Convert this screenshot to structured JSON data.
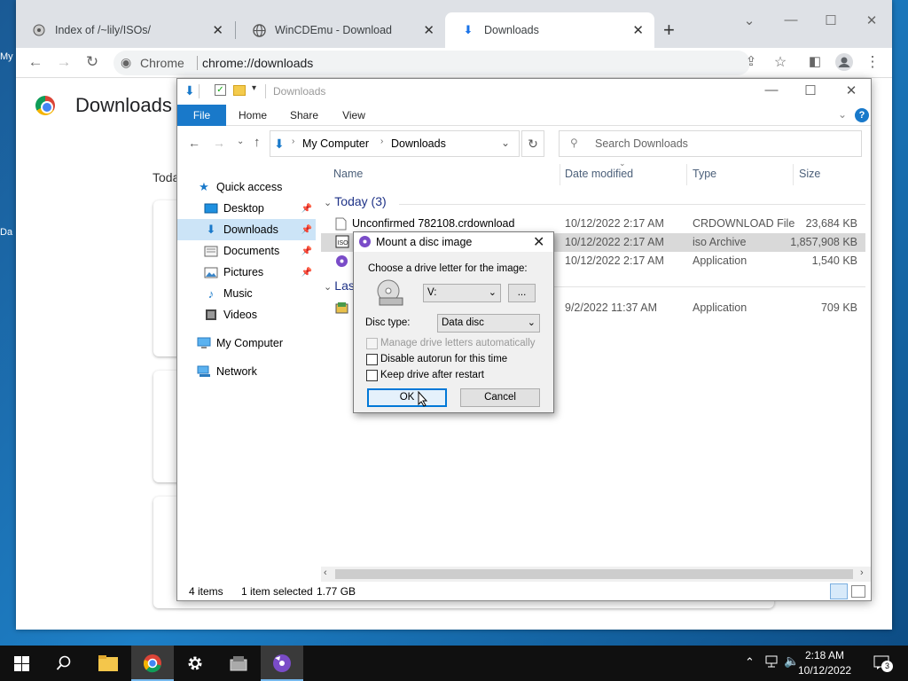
{
  "desktop": {
    "icon_labels": [
      "My",
      "Da"
    ]
  },
  "browser": {
    "tabs": [
      {
        "title": "Index of /~lily/ISOs/"
      },
      {
        "title": "WinCDEmu - Download"
      },
      {
        "title": "Downloads"
      }
    ],
    "omnibox": {
      "site_label": "Chrome",
      "url": "chrome://downloads"
    },
    "page": {
      "title": "Downloads",
      "section_label": "Toda"
    }
  },
  "explorer": {
    "title": "Downloads",
    "ribbon_tabs": [
      "File",
      "Home",
      "Share",
      "View"
    ],
    "help": "?",
    "breadcrumb": [
      "My Computer",
      "Downloads"
    ],
    "search_placeholder": "Search Downloads",
    "nav": [
      {
        "label": "Quick access",
        "icon": "star-icon"
      },
      {
        "label": "Desktop",
        "icon": "desktop-icon",
        "pinned": true
      },
      {
        "label": "Downloads",
        "icon": "download-arrow-icon",
        "pinned": true,
        "selected": true
      },
      {
        "label": "Documents",
        "icon": "documents-icon",
        "pinned": true
      },
      {
        "label": "Pictures",
        "icon": "pictures-icon",
        "pinned": true
      },
      {
        "label": "Music",
        "icon": "music-icon"
      },
      {
        "label": "Videos",
        "icon": "videos-icon"
      },
      {
        "label": "My Computer",
        "icon": "computer-icon"
      },
      {
        "label": "Network",
        "icon": "network-icon"
      }
    ],
    "columns": [
      "Name",
      "Date modified",
      "Type",
      "Size"
    ],
    "groups": [
      {
        "label": "Today (3)"
      },
      {
        "label": "Las"
      }
    ],
    "files": [
      {
        "name": "Unconfirmed 782108.crdownload",
        "date": "10/12/2022 2:17 AM",
        "type": "CRDOWNLOAD File",
        "size": "23,684 KB"
      },
      {
        "name": "",
        "date": "10/12/2022 2:17 AM",
        "type": "iso Archive",
        "size": "1,857,908 KB"
      },
      {
        "name": "",
        "date": "10/12/2022 2:17 AM",
        "type": "Application",
        "size": "1,540 KB"
      },
      {
        "name": "",
        "date": "9/2/2022 11:37 AM",
        "type": "Application",
        "size": "709 KB"
      }
    ],
    "status": {
      "items": "4 items",
      "selected": "1 item selected",
      "size": "1.77 GB"
    }
  },
  "dialog": {
    "title": "Mount a disc image",
    "drive_prompt": "Choose a drive letter for the image:",
    "drive_value": "V:",
    "browse_label": "...",
    "disc_type_label": "Disc type:",
    "disc_type_value": "Data disc",
    "opt_manage": "Manage drive letters automatically",
    "opt_autorun": "Disable autorun for this time",
    "opt_keep": "Keep drive after restart",
    "ok_label": "OK",
    "cancel_label": "Cancel"
  },
  "taskbar": {
    "time": "2:18 AM",
    "date": "10/12/2022",
    "notification_count": "3"
  },
  "colors": {
    "accent": "#1979ca",
    "selection": "#cce4f7",
    "taskbar": "#101010"
  }
}
